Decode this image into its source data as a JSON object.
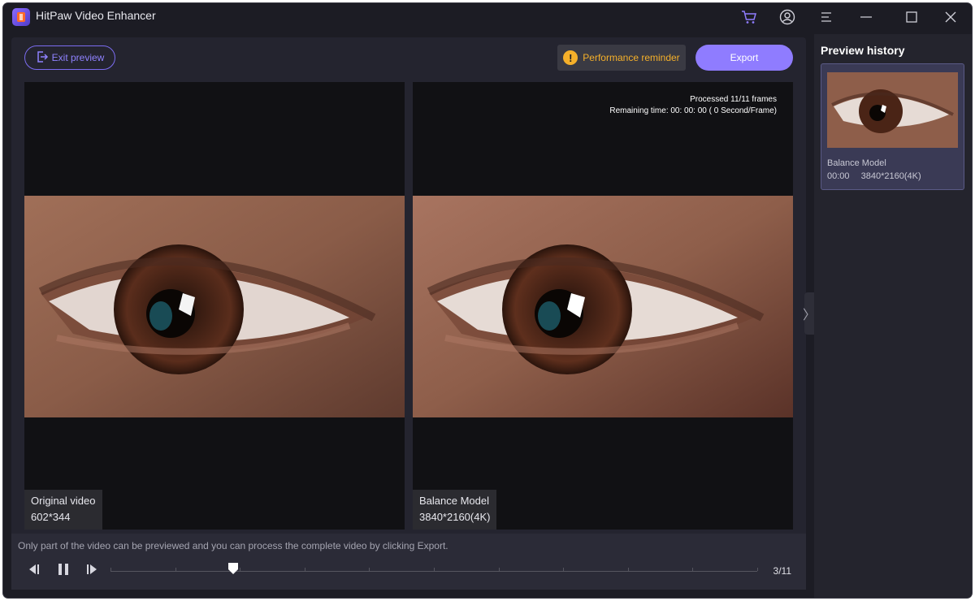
{
  "app": {
    "title": "HitPaw Video Enhancer"
  },
  "titlebar": {
    "icons": [
      "cart-icon",
      "account-icon",
      "menu-icon",
      "minimize-icon",
      "maximize-icon",
      "close-icon"
    ]
  },
  "toolbar": {
    "exit_label": "Exit preview",
    "performance_label": "Performance reminder",
    "export_label": "Export"
  },
  "preview": {
    "left": {
      "title": "Original video",
      "size": "602*344"
    },
    "right": {
      "title": "Balance Model",
      "size": "3840*2160(4K)",
      "processed": "Processed 11/11 frames",
      "remaining": "Remaining time: 00: 00: 00 ( 0 Second/Frame)"
    }
  },
  "playback": {
    "hint": "Only part of the video can be previewed and you can process the complete video by clicking Export.",
    "frame_counter": "3/11",
    "current_frame": 3,
    "total_frames": 11,
    "controls": [
      "previous-frame-icon",
      "pause-icon",
      "next-frame-icon"
    ]
  },
  "sidebar": {
    "title": "Preview history",
    "items": [
      {
        "model": "Balance Model",
        "time": "00:00",
        "resolution": "3840*2160(4K)"
      }
    ]
  },
  "colors": {
    "accent": "#8f7cff",
    "warning": "#f5b02a",
    "background": "#1c1c24"
  }
}
